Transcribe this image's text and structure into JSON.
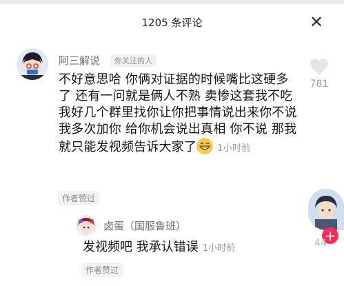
{
  "header": {
    "title": "1205 条评论",
    "close_icon": "close-icon"
  },
  "comment": {
    "author": "阿三解说",
    "author_tag": "你关注的人",
    "text": "不好意思哈 你俩对证据的时候嘴比这硬多了 还有一问就是俩人不熟 卖惨这套我不吃 我好几个群里找你让你把事情说出来你不说 我多次加你 给你机会说出真相 你不说 那我就只能发视频告诉大家了",
    "emoji": "grinning-face-emoji",
    "time": "1小时前",
    "liked_badge": "作者赞过",
    "like_count": "781"
  },
  "reply": {
    "author": "卤蛋（国服鲁班）",
    "text": "发视频吧 我承认错误",
    "time": "1小时前",
    "liked_badge": "作者赞过",
    "like_count": "44"
  },
  "floating": {
    "plus_label": "+"
  },
  "colors": {
    "accent": "#fe2c55",
    "muted": "#9a9a9a"
  }
}
